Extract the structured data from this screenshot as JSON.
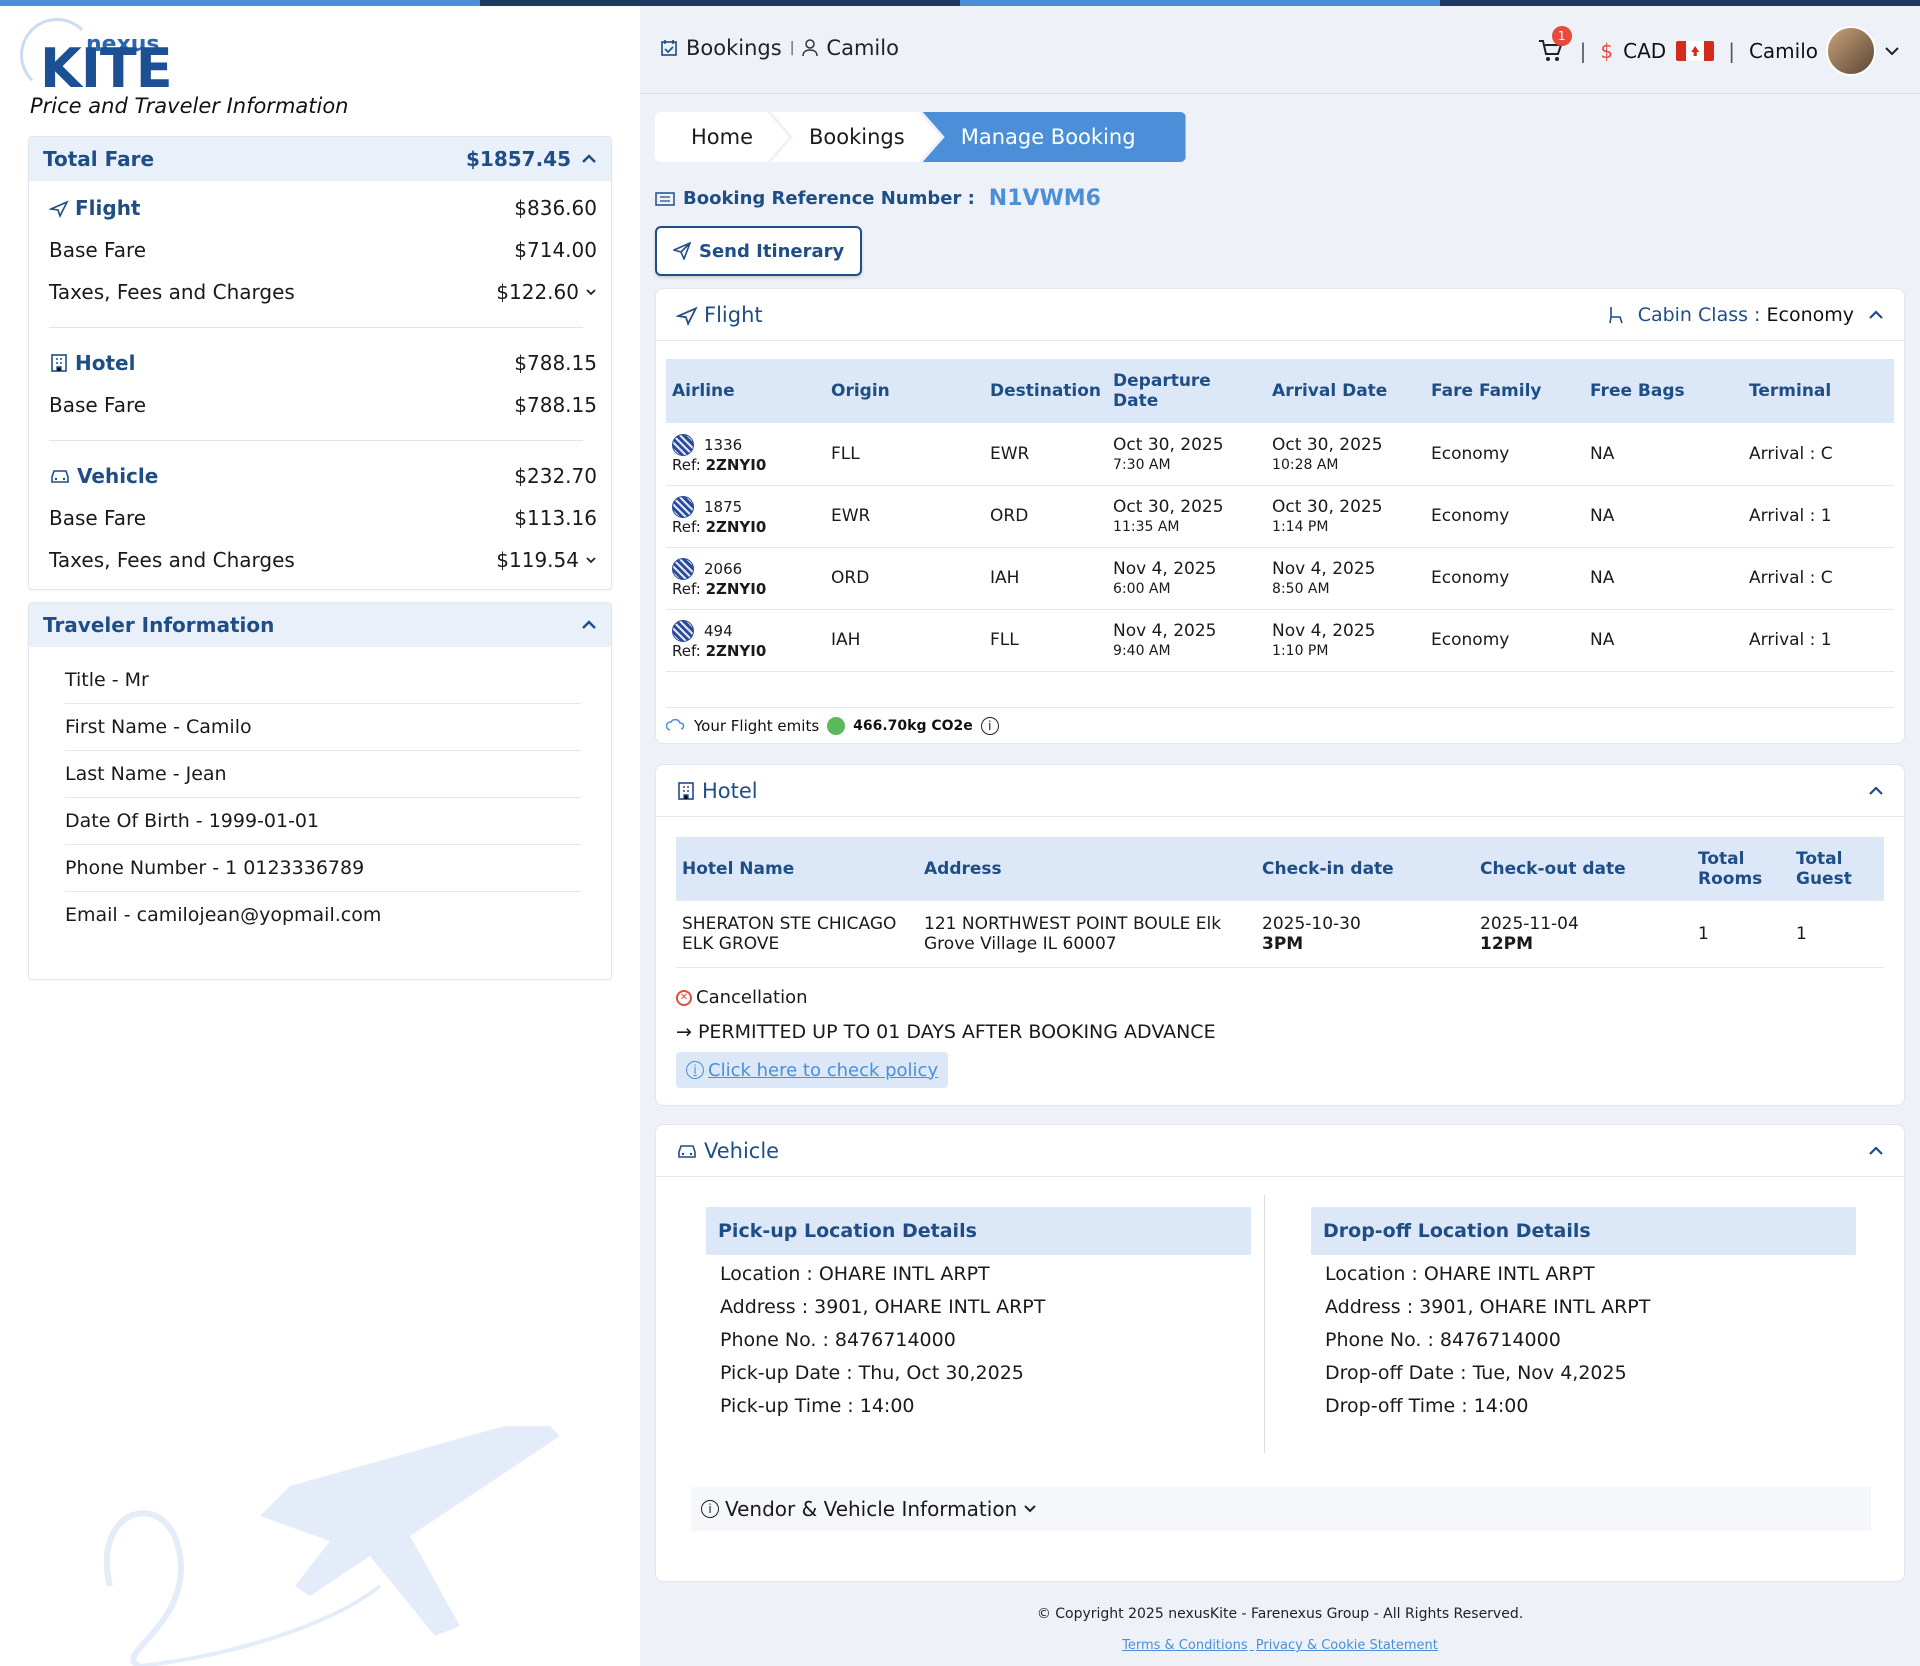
{
  "logo": {
    "nexus": "nexus",
    "kite": "KITE"
  },
  "left_title": "Price and Traveler Information",
  "fare": {
    "total_label": "Total Fare",
    "total_amount": "$1857.45",
    "flight": {
      "label": "Flight",
      "amount": "$836.60",
      "base_label": "Base Fare",
      "base": "$714.00",
      "tax_label": "Taxes, Fees and Charges",
      "tax": "$122.60"
    },
    "hotel": {
      "label": "Hotel",
      "amount": "$788.15",
      "base_label": "Base Fare",
      "base": "$788.15"
    },
    "vehicle": {
      "label": "Vehicle",
      "amount": "$232.70",
      "base_label": "Base Fare",
      "base": "$113.16",
      "tax_label": "Taxes, Fees and Charges",
      "tax": "$119.54"
    }
  },
  "traveler": {
    "title": "Traveler Information",
    "rows": [
      "Title - Mr",
      "First Name - Camilo",
      "Last Name - Jean",
      "Date Of Birth - 1999-01-01",
      "Phone Number - 1 0123336789",
      "Email - camilojean@yopmail.com"
    ]
  },
  "header": {
    "bookings": "Bookings",
    "user_link": "Camilo",
    "cart_count": "1",
    "currency_symbol": "$",
    "currency": "CAD",
    "user": "Camilo"
  },
  "breadcrumbs": [
    "Home",
    "Bookings",
    "Manage Booking"
  ],
  "booking_ref": {
    "label": "Booking Reference Number :",
    "value": "N1VWM6"
  },
  "send_itinerary": "Send Itinerary",
  "flight": {
    "title": "Flight",
    "cabin_label": "Cabin Class :",
    "cabin_value": "Economy",
    "columns": [
      "Airline",
      "Origin",
      "Destination",
      "Departure Date",
      "Arrival Date",
      "Fare Family",
      "Free Bags",
      "Terminal"
    ],
    "rows": [
      {
        "num": "1336",
        "ref_label": "Ref:",
        "ref": "2ZNYI0",
        "origin": "FLL",
        "dest": "EWR",
        "dep_date": "Oct 30, 2025",
        "dep_time": "7:30 AM",
        "arr_date": "Oct 30, 2025",
        "arr_time": "10:28 AM",
        "fare": "Economy",
        "bags": "NA",
        "terminal": "Arrival : C"
      },
      {
        "num": "1875",
        "ref_label": "Ref:",
        "ref": "2ZNYI0",
        "origin": "EWR",
        "dest": "ORD",
        "dep_date": "Oct 30, 2025",
        "dep_time": "11:35 AM",
        "arr_date": "Oct 30, 2025",
        "arr_time": "1:14 PM",
        "fare": "Economy",
        "bags": "NA",
        "terminal": "Arrival : 1"
      },
      {
        "num": "2066",
        "ref_label": "Ref:",
        "ref": "2ZNYI0",
        "origin": "ORD",
        "dest": "IAH",
        "dep_date": "Nov 4, 2025",
        "dep_time": "6:00 AM",
        "arr_date": "Nov 4, 2025",
        "arr_time": "8:50 AM",
        "fare": "Economy",
        "bags": "NA",
        "terminal": "Arrival : C"
      },
      {
        "num": "494",
        "ref_label": "Ref:",
        "ref": "2ZNYI0",
        "origin": "IAH",
        "dest": "FLL",
        "dep_date": "Nov 4, 2025",
        "dep_time": "9:40 AM",
        "arr_date": "Nov 4, 2025",
        "arr_time": "1:10 PM",
        "fare": "Economy",
        "bags": "NA",
        "terminal": "Arrival : 1"
      }
    ],
    "emits_label": "Your Flight emits",
    "emits_value": "466.70kg CO2e"
  },
  "hotel": {
    "title": "Hotel",
    "columns": [
      "Hotel Name",
      "Address",
      "Check-in date",
      "Check-out date",
      "Total Rooms",
      "Total Guest"
    ],
    "row": {
      "name": "SHERATON STE CHICAGO ELK GROVE",
      "address": "121 NORTHWEST POINT BOULE Elk Grove Village IL 60007",
      "checkin_date": "2025-10-30",
      "checkin_time": "3PM",
      "checkout_date": "2025-11-04",
      "checkout_time": "12PM",
      "rooms": "1",
      "guests": "1"
    },
    "cancellation": "Cancellation",
    "permitted": "PERMITTED UP TO 01 DAYS AFTER BOOKING ADVANCE",
    "policy_link": "Click here to check policy"
  },
  "vehicle": {
    "title": "Vehicle",
    "pickup": {
      "title": "Pick-up Location Details",
      "lines": [
        "Location : OHARE INTL ARPT",
        "Address : 3901, OHARE INTL ARPT",
        "Phone No. : 8476714000",
        "Pick-up Date : Thu, Oct 30,2025",
        "Pick-up Time : 14:00"
      ]
    },
    "dropoff": {
      "title": "Drop-off Location Details",
      "lines": [
        "Location : OHARE INTL ARPT",
        "Address : 3901, OHARE INTL ARPT",
        "Phone No. : 8476714000",
        "Drop-off Date : Tue, Nov 4,2025",
        "Drop-off Time : 14:00"
      ]
    },
    "vendor_label": "Vendor & Vehicle Information"
  },
  "footer": {
    "copyright": "© Copyright 2025 nexusKite - Farenexus Group - All Rights Reserved.",
    "terms": "Terms & Conditions",
    "privacy": "Privacy & Cookie Statement"
  },
  "colors": {
    "primary": "#1f4e86",
    "accent": "#4a8fd8",
    "header_bg": "#dce8f8",
    "badge": "#e64b3c"
  }
}
